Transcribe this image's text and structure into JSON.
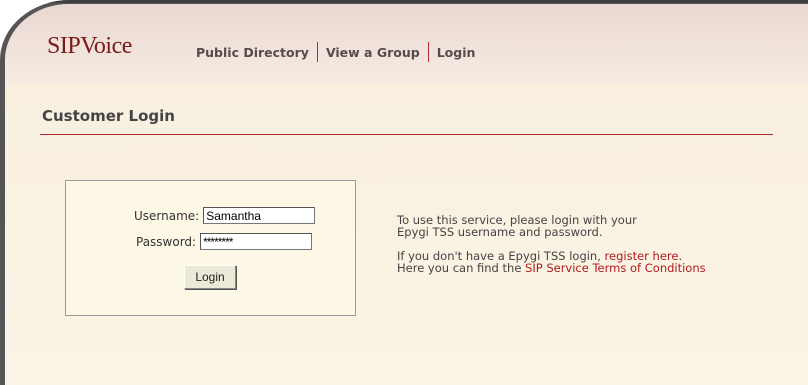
{
  "logo": "SIPVoice",
  "nav": [
    "Public Directory",
    "View a Group",
    "Login"
  ],
  "section_title": "Customer Login",
  "form": {
    "username_label": "Username:",
    "username_value": "Samantha",
    "password_label": "Password:",
    "password_value": "********",
    "login_button": "Login"
  },
  "info": {
    "line1": "To use this service, please login with your",
    "line2": "Epygi TSS username and password.",
    "line3_prefix": "If you don't have a Epygi TSS login, ",
    "line3_link": "register here",
    "line3_suffix": ".",
    "line4_prefix": "Here you can find the ",
    "line4_link": "SIP Service Terms of Conditions"
  },
  "colors": {
    "accent": "#b42a2a",
    "link": "#b01c1c"
  }
}
